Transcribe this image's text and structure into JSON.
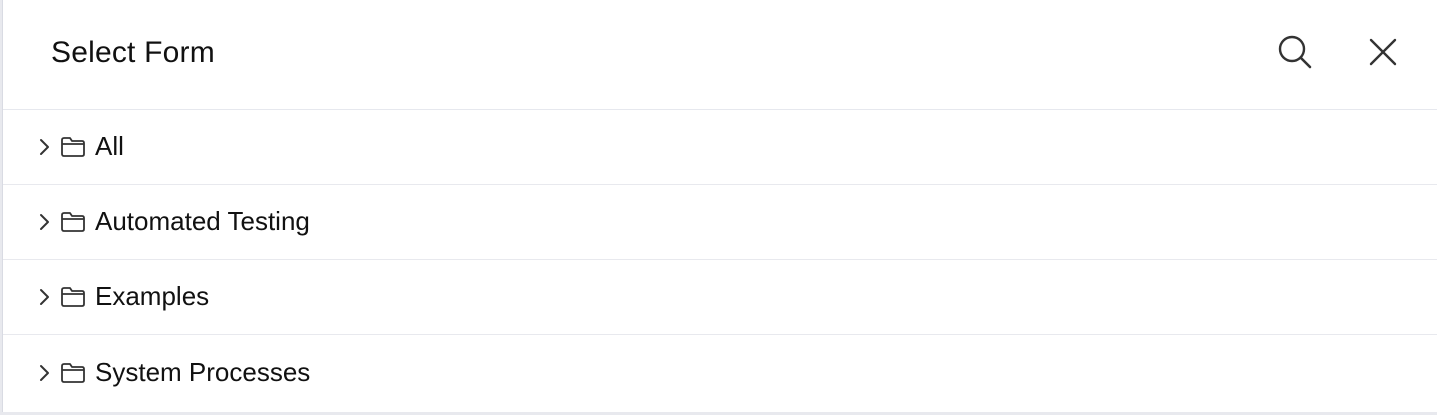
{
  "dialog": {
    "title": "Select Form",
    "search_icon": "search-icon",
    "close_icon": "close-icon"
  },
  "tree": {
    "items": [
      {
        "label": "All",
        "expand_icon": "chevron-right-icon",
        "icon": "folder-icon"
      },
      {
        "label": "Automated Testing",
        "expand_icon": "chevron-right-icon",
        "icon": "folder-icon"
      },
      {
        "label": "Examples",
        "expand_icon": "chevron-right-icon",
        "icon": "folder-icon"
      },
      {
        "label": "System Processes",
        "expand_icon": "chevron-right-icon",
        "icon": "folder-icon"
      }
    ]
  },
  "colors": {
    "background": "#ffffff",
    "text": "#111111",
    "divider": "#e8e9ee",
    "icon": "#333333"
  }
}
